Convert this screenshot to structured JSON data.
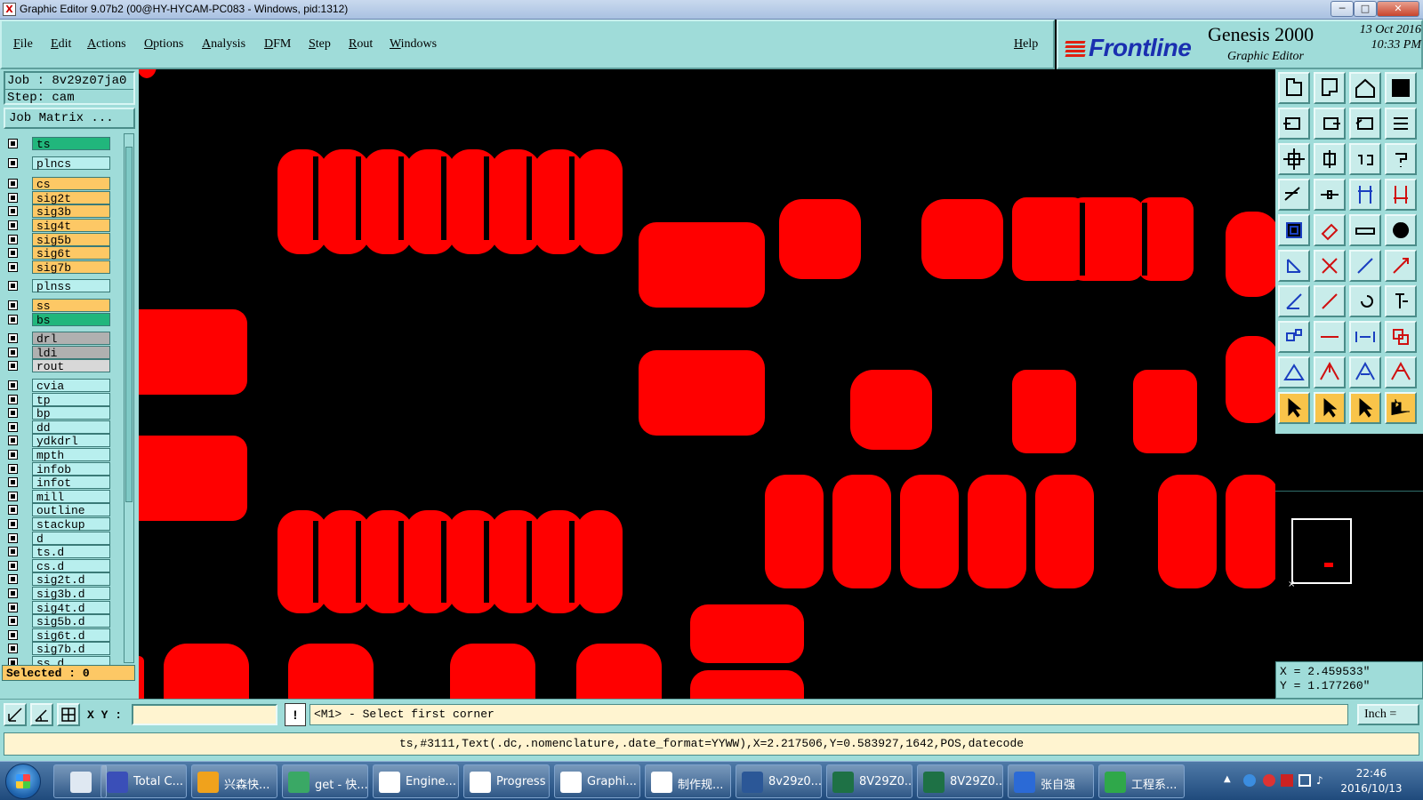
{
  "window": {
    "title": "Graphic Editor 9.07b2 (00@HY-HYCAM-PC083 - Windows, pid:1312)",
    "min_label": "─",
    "max_label": "□",
    "close_label": "✕"
  },
  "menu": {
    "items": [
      "File",
      "Edit",
      "Actions",
      "Options",
      "Analysis",
      "DFM",
      "Step",
      "Rout",
      "Windows"
    ],
    "help": "Help"
  },
  "brand": {
    "logo": "Frontline",
    "product": "Genesis 2000",
    "subtitle": "Graphic Editor",
    "date": "13 Oct 2016",
    "time": "10:33 PM"
  },
  "job": {
    "job_line": "Job : 8v29z07ja0",
    "step_line": "Step: cam",
    "matrix_button": "Job Matrix ..."
  },
  "layers": [
    {
      "name": "ts",
      "type": "active"
    },
    {
      "name": "plncs",
      "type": "plane"
    },
    {
      "name": "cs",
      "type": "board"
    },
    {
      "name": "sig2t",
      "type": "board"
    },
    {
      "name": "sig3b",
      "type": "board"
    },
    {
      "name": "sig4t",
      "type": "board"
    },
    {
      "name": "sig5b",
      "type": "board"
    },
    {
      "name": "sig6t",
      "type": "board"
    },
    {
      "name": "sig7b",
      "type": "board"
    },
    {
      "name": "plnss",
      "type": "plane"
    },
    {
      "name": "ss",
      "type": "board"
    },
    {
      "name": "bs",
      "type": "solder"
    },
    {
      "name": "drl",
      "type": "drill"
    },
    {
      "name": "ldi",
      "type": "drill"
    },
    {
      "name": "rout",
      "type": "rout"
    },
    {
      "name": "cvia",
      "type": "doc"
    },
    {
      "name": "tp",
      "type": "doc"
    },
    {
      "name": "bp",
      "type": "doc"
    },
    {
      "name": "dd",
      "type": "doc"
    },
    {
      "name": "ydkdrl",
      "type": "doc"
    },
    {
      "name": "mpth",
      "type": "doc"
    },
    {
      "name": "infob",
      "type": "doc"
    },
    {
      "name": "infot",
      "type": "doc"
    },
    {
      "name": "mill",
      "type": "doc"
    },
    {
      "name": "outline",
      "type": "doc"
    },
    {
      "name": "stackup",
      "type": "doc"
    },
    {
      "name": "d",
      "type": "doc"
    },
    {
      "name": "ts.d",
      "type": "doc"
    },
    {
      "name": "cs.d",
      "type": "doc"
    },
    {
      "name": "sig2t.d",
      "type": "doc"
    },
    {
      "name": "sig3b.d",
      "type": "doc"
    },
    {
      "name": "sig4t.d",
      "type": "doc"
    },
    {
      "name": "sig5b.d",
      "type": "doc"
    },
    {
      "name": "sig6t.d",
      "type": "doc"
    },
    {
      "name": "sig7b.d",
      "type": "doc"
    },
    {
      "name": "ss.d",
      "type": "doc"
    }
  ],
  "selected": "Selected : 0",
  "coords": {
    "x": "X = 2.459533\"",
    "y": "Y = 1.177260\""
  },
  "command": {
    "xy_label": "X Y :",
    "xy_value": "",
    "bang": "!",
    "prompt": "<M1> - Select first corner",
    "units": "Inch ="
  },
  "status_line": "ts,#3111,Text(.dc,.nomenclature,.date_format=YYWW),X=2.217506,Y=0.583927,1642,POS,datecode",
  "taskbar": {
    "tasks": [
      {
        "label": "",
        "icon": "calculator-icon",
        "color": "#dfe8f2",
        "pinned": true
      },
      {
        "label": "Total C...",
        "icon": "total-commander-icon",
        "color": "#3a4fb8"
      },
      {
        "label": "兴森快...",
        "icon": "xingsen-icon",
        "color": "#f0a21c"
      },
      {
        "label": "get - 快...",
        "icon": "eye-icon",
        "color": "#3aa865"
      },
      {
        "label": "Engine...",
        "icon": "genesis-app-icon",
        "color": "#ffffff"
      },
      {
        "label": "Progress",
        "icon": "genesis-app-icon",
        "color": "#ffffff"
      },
      {
        "label": "Graphi...",
        "icon": "genesis-app-icon",
        "color": "#ffffff"
      },
      {
        "label": "制作规...",
        "icon": "document-icon",
        "color": "#ffffff"
      },
      {
        "label": "8v29z0...",
        "icon": "word-icon",
        "color": "#2b5797"
      },
      {
        "label": "8V29Z0...",
        "icon": "excel-icon",
        "color": "#1e7145"
      },
      {
        "label": "8V29Z0...",
        "icon": "excel-icon",
        "color": "#1e7145"
      },
      {
        "label": "张自强",
        "icon": "frontline-icon",
        "color": "#2b6ad6"
      },
      {
        "label": "工程系...",
        "icon": "fp-icon",
        "color": "#2fa84a"
      }
    ],
    "clock_time": "22:46",
    "clock_date": "2016/10/13"
  },
  "colors": {
    "panel": "#9fdcd9",
    "pad": "#ff0000",
    "board_layer": "#fdc865",
    "active_layer": "#21b67c"
  }
}
